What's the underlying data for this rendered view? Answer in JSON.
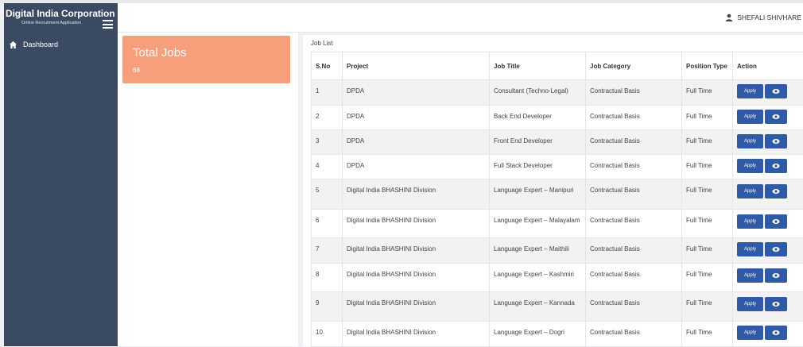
{
  "brand": {
    "title": "Digital India Corporation",
    "subtitle": "Online Recruitment Application"
  },
  "sidebar": {
    "items": [
      {
        "label": "Dashboard",
        "icon": "home-icon"
      }
    ]
  },
  "header": {
    "user_name": "SHEFALI SHIVHARE",
    "user_icon": "user-icon"
  },
  "summary_card": {
    "title": "Total Jobs",
    "count": "68",
    "color": "#f79f7a"
  },
  "job_list": {
    "title": "Job List",
    "columns": [
      "S.No",
      "Project",
      "Job Title",
      "Job Category",
      "Position Type",
      "Action"
    ],
    "apply_label": "Apply",
    "rows": [
      {
        "sno": "1",
        "project": "DPDA",
        "title": "Consultant (Techno-Legal)",
        "category": "Contractual Basis",
        "position": "Full Time"
      },
      {
        "sno": "2",
        "project": "DPDA",
        "title": "Back End Developer",
        "category": "Contractual Basis",
        "position": "Full Time"
      },
      {
        "sno": "3",
        "project": "DPDA",
        "title": "Front End Developer",
        "category": "Contractual Basis",
        "position": "Full Time"
      },
      {
        "sno": "4",
        "project": "DPDA",
        "title": "Full Stack Developer",
        "category": "Contractual Basis",
        "position": "Full Time"
      },
      {
        "sno": "5",
        "project": "Digital India BHASHINI Division",
        "title": "Language Expert – Manipuri",
        "category": "Contractual Basis",
        "position": "Full Time"
      },
      {
        "sno": "6",
        "project": "Digital India BHASHINI Division",
        "title": "Language Expert – Malayalam",
        "category": "Contractual Basis",
        "position": "Full Time"
      },
      {
        "sno": "7",
        "project": "Digital India BHASHINI Division",
        "title": "Language Expert – Maithili",
        "category": "Contractual Basis",
        "position": "Full Time"
      },
      {
        "sno": "8",
        "project": "Digital India BHASHINI Division",
        "title": "Language Expert – Kashmiri",
        "category": "Contractual Basis",
        "position": "Full Time"
      },
      {
        "sno": "9",
        "project": "Digital India BHASHINI Division",
        "title": "Language Expert – Kannada",
        "category": "Contractual Basis",
        "position": "Full Time"
      },
      {
        "sno": "10",
        "project": "Digital India BHASHINI Division",
        "title": "Language Expert – Dogri",
        "category": "Contractual Basis",
        "position": "Full Time"
      }
    ]
  },
  "colors": {
    "sidebar": "#3b4a63",
    "button": "#2e5aa7",
    "card": "#f79f7a"
  }
}
